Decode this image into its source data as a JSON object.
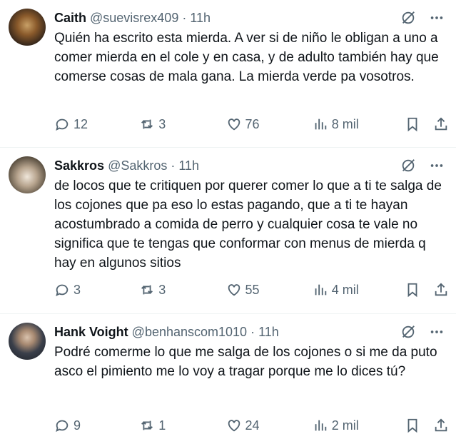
{
  "tweets": [
    {
      "name": "Caith",
      "handle": "@suevisrex409",
      "time": "11h",
      "text": "Quién ha escrito esta mierda. A ver si de niño le obligan a uno a comer mierda en el cole y en casa, y de adulto también hay que comerse cosas de mala gana. La mierda verde pa vosotros.",
      "replies": "12",
      "reposts": "3",
      "likes": "76",
      "views": "8 mil"
    },
    {
      "name": "Sakkros",
      "handle": "@Sakkros",
      "time": "11h",
      "text": "de locos que te critiquen por querer comer lo que a ti te salga de los cojones que pa eso lo estas pagando, que a ti te hayan acostumbrado a comida de perro y cualquier cosa te vale no significa que te tengas que conformar con menus de mierda q hay en algunos sitios",
      "replies": "3",
      "reposts": "3",
      "likes": "55",
      "views": "4 mil"
    },
    {
      "name": "Hank Voight",
      "handle": "@benhanscom1010",
      "time": "11h",
      "text": "Podré comerme lo que me salga de los cojones o si me da puto asco el pimiento me lo voy a tragar porque me lo dices tú?",
      "replies": "9",
      "reposts": "1",
      "likes": "24",
      "views": "2 mil"
    }
  ],
  "separator": "·",
  "icons": {
    "grok": "grok-icon",
    "more": "more-icon",
    "reply": "reply-icon",
    "repost": "repost-icon",
    "like": "heart-icon",
    "views": "views-icon",
    "bookmark": "bookmark-icon",
    "share": "share-icon"
  },
  "colors": {
    "text": "#0f1419",
    "secondary": "#536471",
    "border": "#eff3f4"
  }
}
